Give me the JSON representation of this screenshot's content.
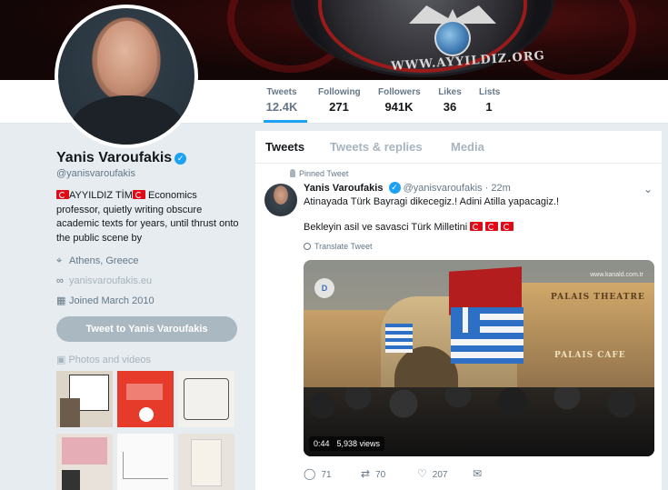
{
  "banner": {
    "seal_text": "WWW.AYYILDIZ.ORG"
  },
  "profile": {
    "name": "Yanis Varoufakis",
    "handle": "@yanisvaroufakis",
    "bio_prefix": "AYYILDIZ TİM",
    "bio": "Economics professor, quietly writing obscure academic texts for years, until thrust onto the public scene by",
    "location": "Athens, Greece",
    "website": "yanisvaroufakis.eu",
    "joined": "Joined March 2010",
    "tweet_to_button": "Tweet to Yanis Varoufakis",
    "photos_label": "Photos and videos"
  },
  "nav": {
    "stats": [
      {
        "label": "Tweets",
        "value": "12.4K"
      },
      {
        "label": "Following",
        "value": "271"
      },
      {
        "label": "Followers",
        "value": "941K"
      },
      {
        "label": "Likes",
        "value": "36"
      },
      {
        "label": "Lists",
        "value": "1"
      }
    ]
  },
  "timeline": {
    "tabs": [
      "Tweets",
      "Tweets & replies",
      "Media"
    ],
    "pinned_label": "Pinned Tweet",
    "tweet": {
      "name": "Yanis Varoufakis",
      "handle": "@yanisvaroufakis",
      "time": "· 22m",
      "line1": "Atinayada Türk Bayragi dikecegiz.! Adini Atilla yapacagiz.!",
      "line2": "Bekleyin asil ve savasci Türk Milletini",
      "translate": "Translate Tweet",
      "video": {
        "duration": "0:44",
        "views": "5,938 views",
        "watermark": "www.kanald.com.tr",
        "sign_top": "PALAIS THEATRE",
        "sign_bottom": "PALAIS CAFE"
      },
      "actions": {
        "replies": "71",
        "retweets": "70",
        "likes": "207"
      }
    }
  },
  "colors": {
    "accent": "#1da1f2",
    "turkish_red": "#e30a17"
  }
}
